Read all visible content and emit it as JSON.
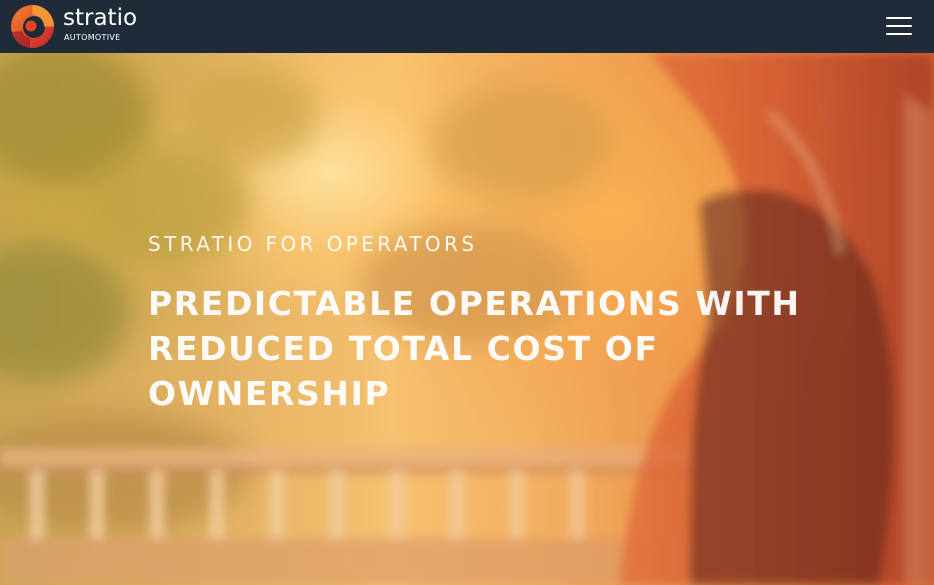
{
  "header": {
    "logo": {
      "wordmark": "stratio",
      "subtitle": "AUTOMOTIVE"
    },
    "menu_icon": "hamburger-menu-icon"
  },
  "hero": {
    "eyebrow": "STRATIO FOR OPERATORS",
    "headline_lines": [
      "PREDICTABLE OPERATIONS WITH",
      "REDUCED TOTAL COST OF",
      "OWNERSHIP"
    ]
  },
  "colors": {
    "nav_background": "#1f2b38",
    "brand_red": "#e0452a",
    "brand_orange": "#f07a2a",
    "hero_text": "#ffffff"
  }
}
